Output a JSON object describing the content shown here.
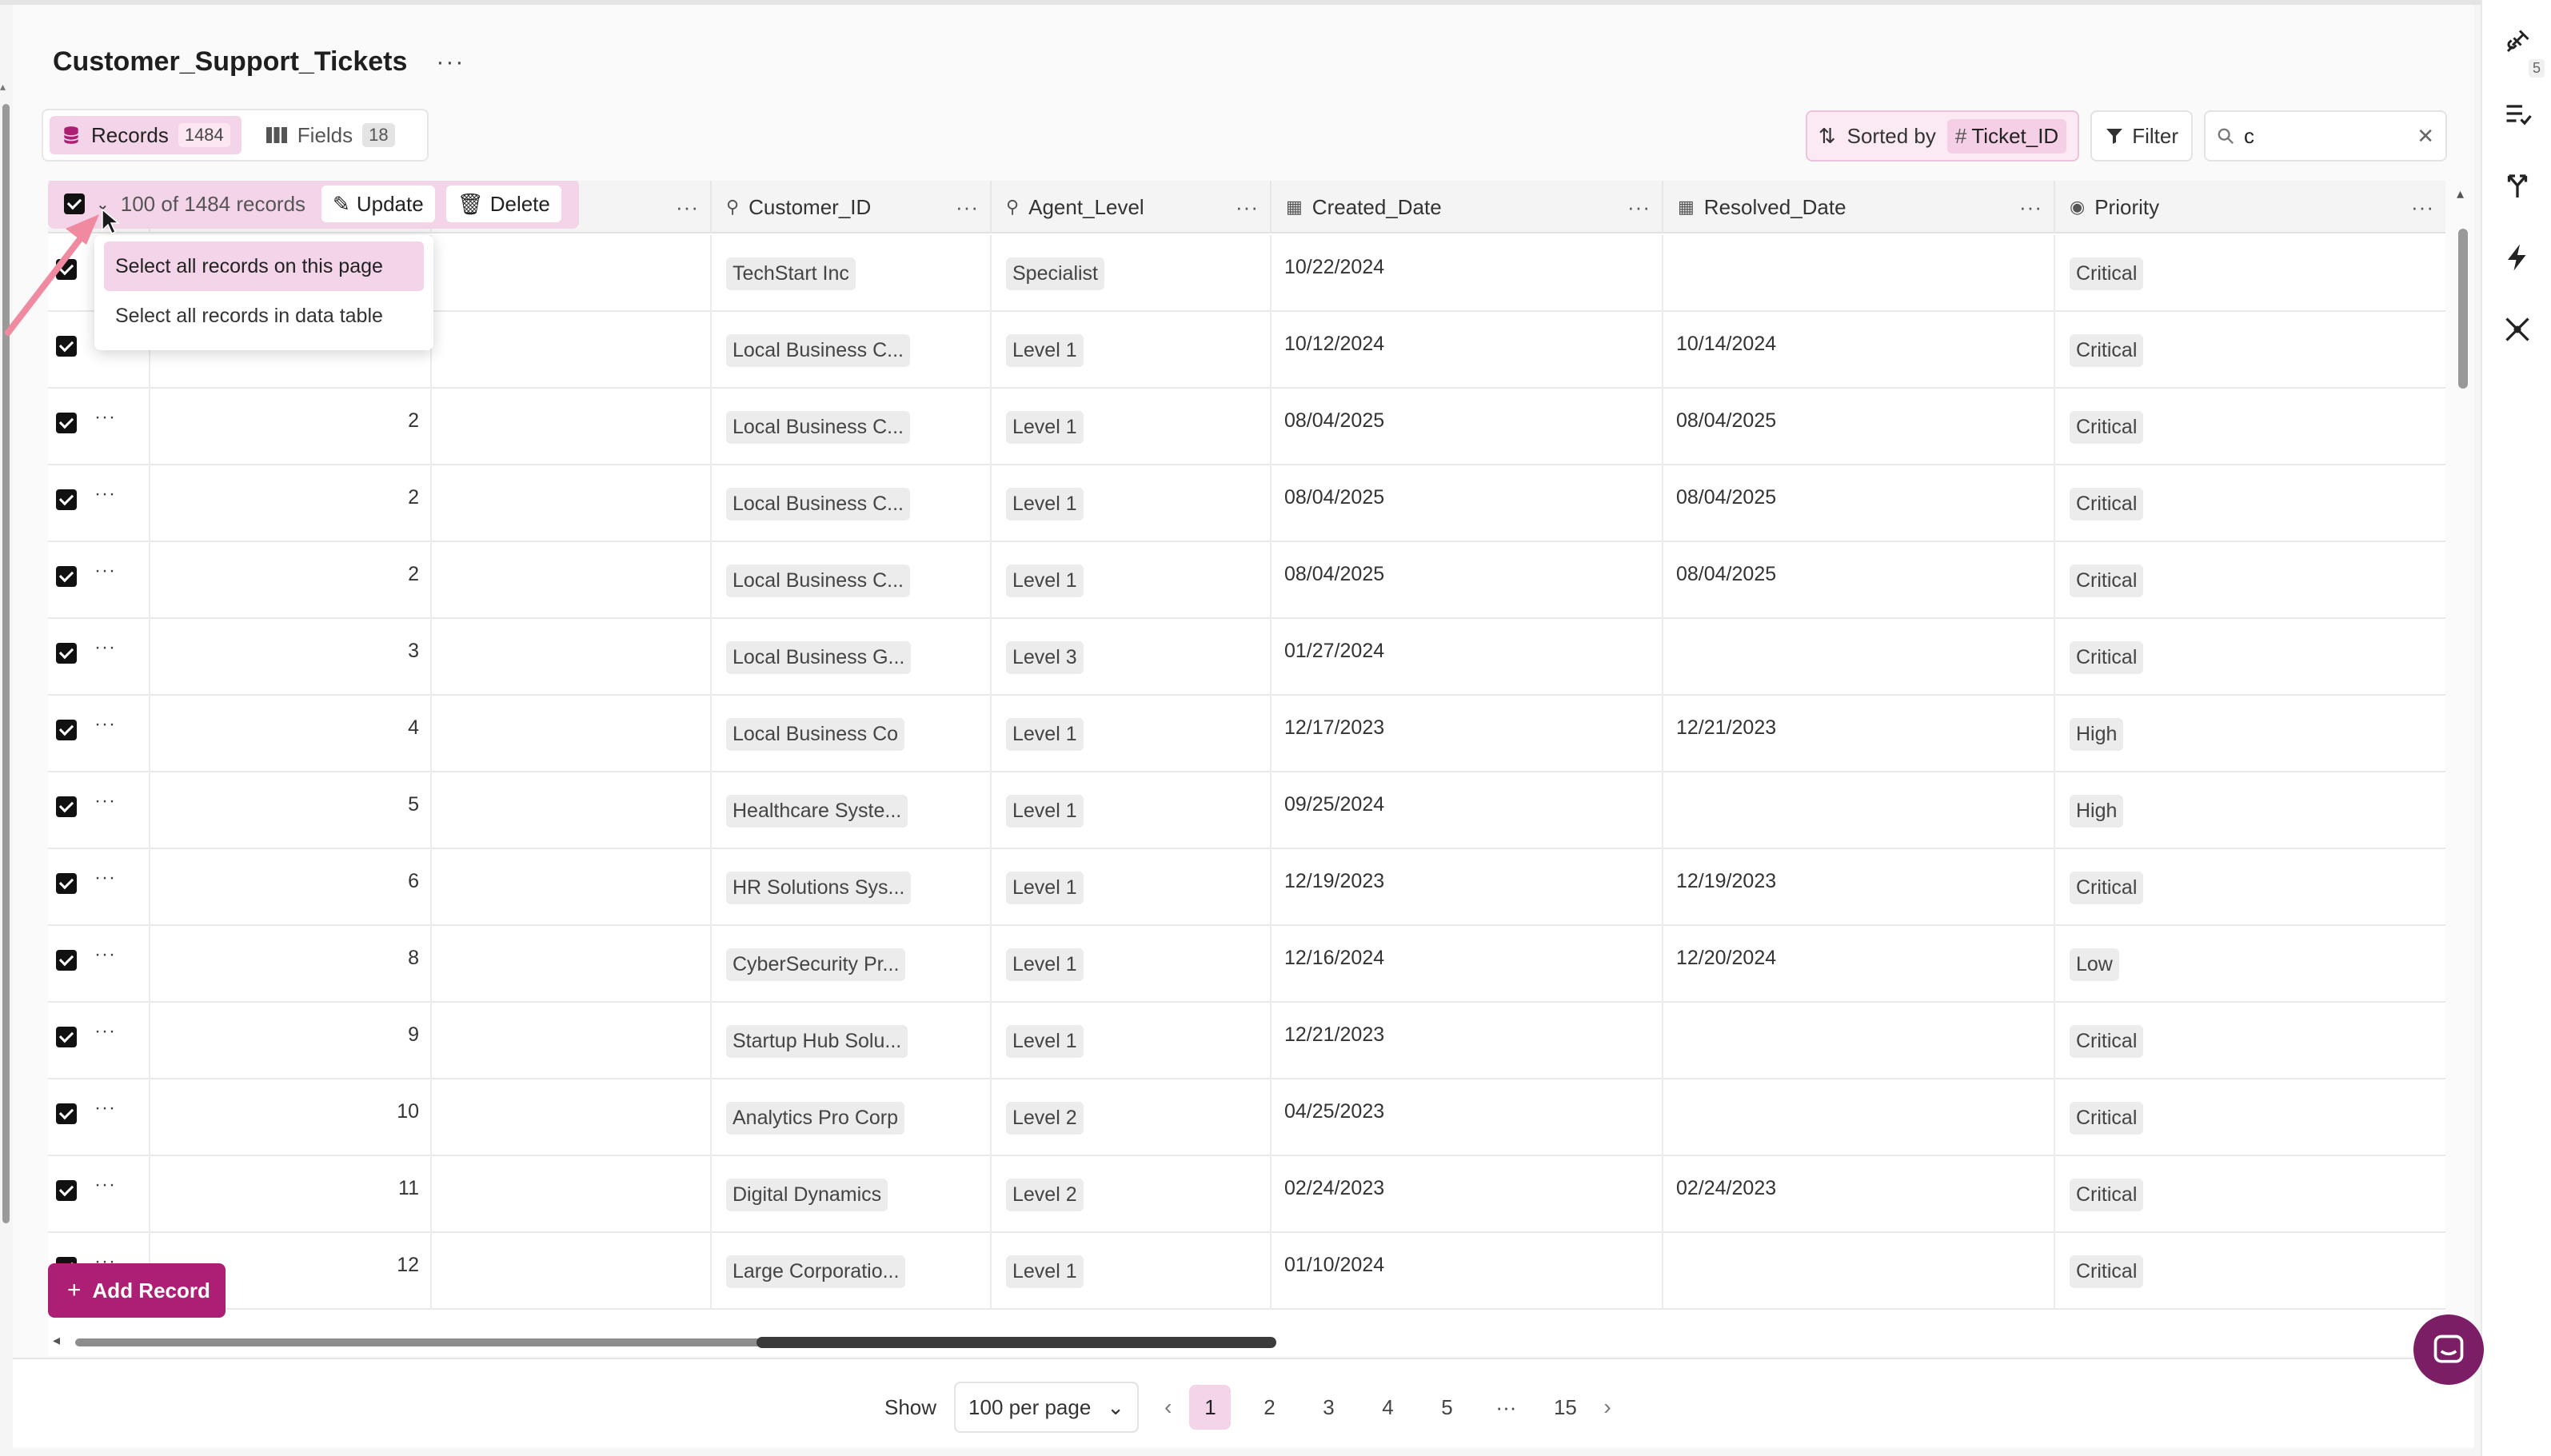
{
  "page": {
    "title": "Customer_Support_Tickets",
    "title_more": "···"
  },
  "tabs": [
    {
      "label": "Records",
      "count": "1484",
      "active": true
    },
    {
      "label": "Fields",
      "count": "18",
      "active": false
    }
  ],
  "toolbar": {
    "sorted_by_label": "Sorted by",
    "sorted_field": "Ticket_ID",
    "filter_label": "Filter",
    "search_value": "c"
  },
  "rail": {
    "badge": "5"
  },
  "selection": {
    "count_label": "100 of 1484 records",
    "update_label": "Update",
    "delete_label": "Delete"
  },
  "dropdown": {
    "items": [
      "Select all records on this page",
      "Select all records in data table"
    ]
  },
  "columns": [
    {
      "label": "Customer_ID",
      "icon": "link-icon"
    },
    {
      "label": "Agent_Level",
      "icon": "link-icon"
    },
    {
      "label": "Created_Date",
      "icon": "calendar-icon"
    },
    {
      "label": "Resolved_Date",
      "icon": "calendar-icon"
    },
    {
      "label": "Priority",
      "icon": "select-icon"
    }
  ],
  "rows": [
    {
      "id": "",
      "customer": "TechStart Inc",
      "agent": "Specialist",
      "created": "10/22/2024",
      "resolved": "",
      "priority": "Critical"
    },
    {
      "id": "",
      "customer": "Local Business C...",
      "agent": "Level 1",
      "created": "10/12/2024",
      "resolved": "10/14/2024",
      "priority": "Critical"
    },
    {
      "id": "2",
      "customer": "Local Business C...",
      "agent": "Level 1",
      "created": "08/04/2025",
      "resolved": "08/04/2025",
      "priority": "Critical"
    },
    {
      "id": "2",
      "customer": "Local Business C...",
      "agent": "Level 1",
      "created": "08/04/2025",
      "resolved": "08/04/2025",
      "priority": "Critical"
    },
    {
      "id": "2",
      "customer": "Local Business C...",
      "agent": "Level 1",
      "created": "08/04/2025",
      "resolved": "08/04/2025",
      "priority": "Critical"
    },
    {
      "id": "3",
      "customer": "Local Business G...",
      "agent": "Level 3",
      "created": "01/27/2024",
      "resolved": "",
      "priority": "Critical"
    },
    {
      "id": "4",
      "customer": "Local Business Co",
      "agent": "Level 1",
      "created": "12/17/2023",
      "resolved": "12/21/2023",
      "priority": "High"
    },
    {
      "id": "5",
      "customer": "Healthcare Syste...",
      "agent": "Level 1",
      "created": "09/25/2024",
      "resolved": "",
      "priority": "High"
    },
    {
      "id": "6",
      "customer": "HR Solutions Sys...",
      "agent": "Level 1",
      "created": "12/19/2023",
      "resolved": "12/19/2023",
      "priority": "Critical"
    },
    {
      "id": "8",
      "customer": "CyberSecurity Pr...",
      "agent": "Level 1",
      "created": "12/16/2024",
      "resolved": "12/20/2024",
      "priority": "Low"
    },
    {
      "id": "9",
      "customer": "Startup Hub Solu...",
      "agent": "Level 1",
      "created": "12/21/2023",
      "resolved": "",
      "priority": "Critical"
    },
    {
      "id": "10",
      "customer": "Analytics Pro Corp",
      "agent": "Level 2",
      "created": "04/25/2023",
      "resolved": "",
      "priority": "Critical"
    },
    {
      "id": "11",
      "customer": "Digital Dynamics",
      "agent": "Level 2",
      "created": "02/24/2023",
      "resolved": "02/24/2023",
      "priority": "Critical"
    },
    {
      "id": "12",
      "customer": "Large Corporatio...",
      "agent": "Level 1",
      "created": "01/10/2024",
      "resolved": "",
      "priority": "Critical"
    }
  ],
  "add_record_label": "Add Record",
  "pagination": {
    "show_label": "Show",
    "per_page": "100 per page",
    "pages": [
      "1",
      "2",
      "3",
      "4",
      "5",
      "···",
      "15"
    ],
    "current": "1"
  },
  "colors": {
    "accent": "#ad1f75",
    "accent_light": "#f3d4e8",
    "annotation_arrow": "#f08aa0"
  }
}
